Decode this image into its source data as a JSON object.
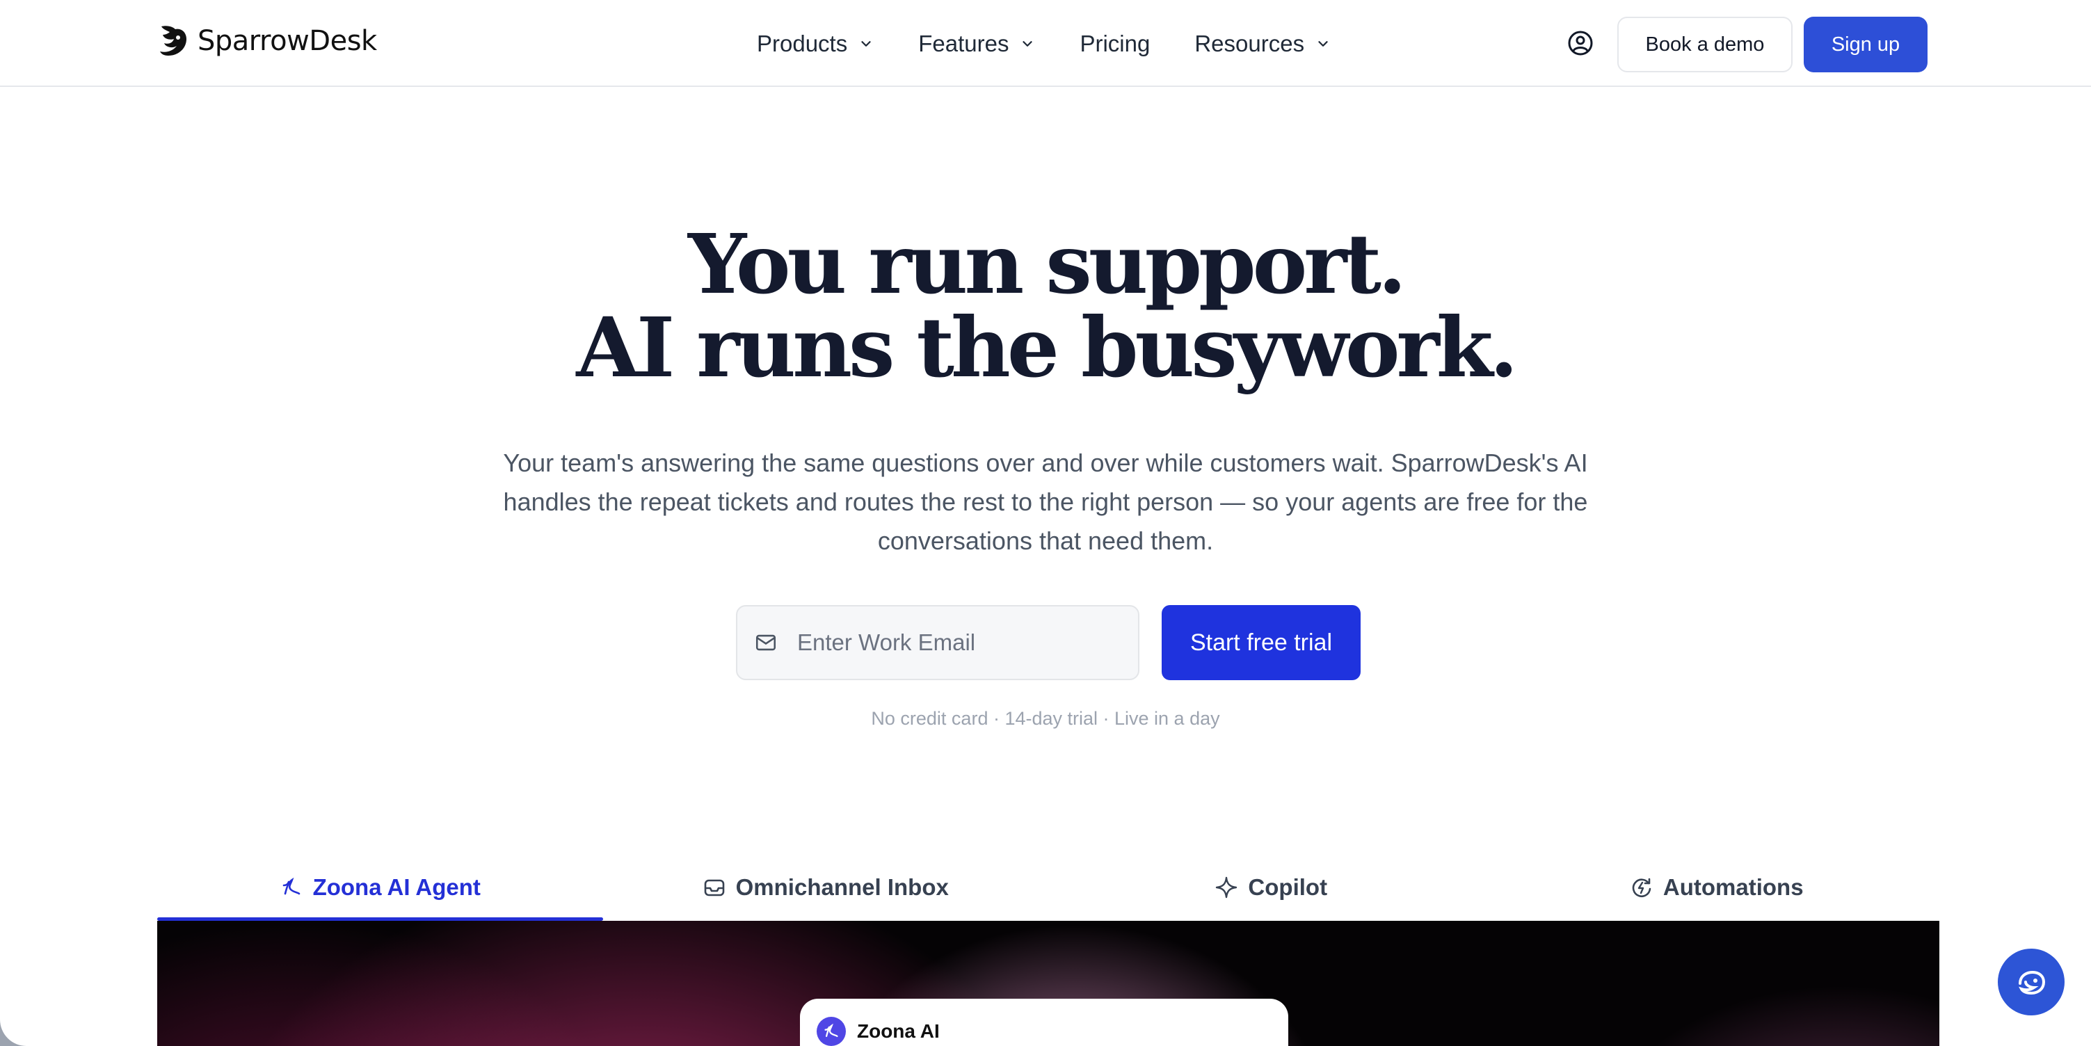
{
  "header": {
    "logo_text": "SparrowDesk",
    "nav": [
      {
        "label": "Products",
        "has_dropdown": true
      },
      {
        "label": "Features",
        "has_dropdown": true
      },
      {
        "label": "Pricing",
        "has_dropdown": false
      },
      {
        "label": "Resources",
        "has_dropdown": true
      }
    ],
    "account_icon": "user-circle-icon",
    "book_demo_label": "Book a demo",
    "signup_label": "Sign up"
  },
  "hero": {
    "title_line1": "You run support.",
    "title_line2": "AI runs the busywork.",
    "subtitle": "Your team's answering the same questions over and over while customers wait. SparrowDesk's AI handles the repeat tickets and routes the rest to the right person — so your agents are free for the conversations that need them.",
    "email_placeholder": "Enter Work Email",
    "email_value": "",
    "cta_label": "Start free trial",
    "note": "No credit card · 14-day trial · Live in a day"
  },
  "tabs": [
    {
      "label": "Zoona AI Agent",
      "icon": "zoona-icon",
      "active": true
    },
    {
      "label": "Omnichannel Inbox",
      "icon": "inbox-icon",
      "active": false
    },
    {
      "label": "Copilot",
      "icon": "sparkle-icon",
      "active": false
    },
    {
      "label": "Automations",
      "icon": "automation-icon",
      "active": false
    }
  ],
  "showcase": {
    "bubble_name": "Zoona AI"
  },
  "colors": {
    "brand_blue": "#2d4fd7",
    "cta_blue": "#1f33de",
    "active_tab": "#2430d6",
    "heading": "#141a2e"
  }
}
